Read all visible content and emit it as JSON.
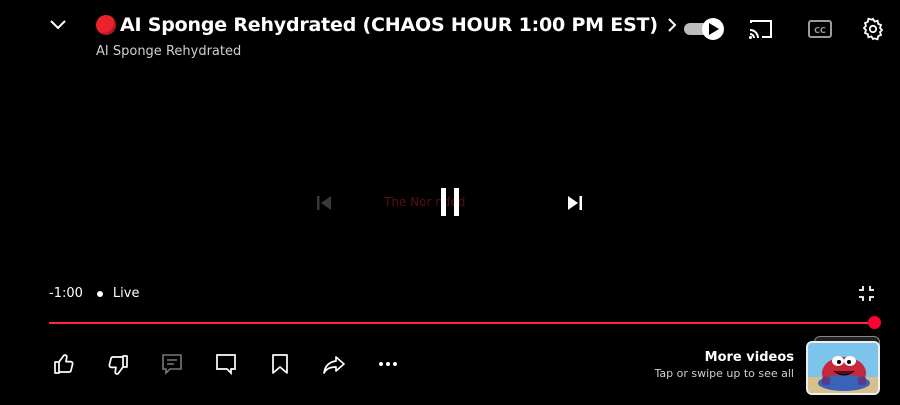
{
  "header": {
    "title": "AI Sponge Rehydrated (CHAOS HOUR 1:00 PM EST)",
    "channel": "AI Sponge Rehydrated",
    "live_dot_color": "#e8232b"
  },
  "player": {
    "center_caption": "The Nor         nded",
    "time": "-1:00",
    "live_label": "Live",
    "progress_color": "#ff0033",
    "progress_fraction": 1.0
  },
  "icons": {
    "collapse": "chevron-down-icon",
    "title_chevron": "chevron-right-icon",
    "autoplay": "autoplay-toggle-icon",
    "cast": "cast-icon",
    "captions": "captions-icon",
    "settings": "gear-icon",
    "previous": "skip-previous-icon",
    "pause": "pause-icon",
    "next": "skip-next-icon",
    "exit_fullscreen": "exit-fullscreen-icon",
    "like": "thumbs-up-icon",
    "dislike": "thumbs-down-icon",
    "comments": "comments-icon",
    "chat": "chat-icon",
    "save": "bookmark-icon",
    "share": "share-icon",
    "more": "more-icon"
  },
  "more_videos": {
    "title": "More videos",
    "subtitle": "Tap or swipe up to see all"
  }
}
